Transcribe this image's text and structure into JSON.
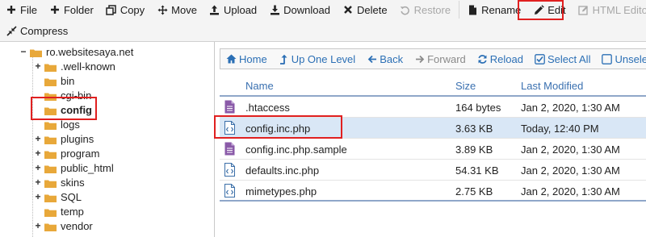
{
  "toolbar": {
    "row1": [
      {
        "key": "file",
        "label": "File",
        "icon": "plus-icon"
      },
      {
        "key": "folder",
        "label": "Folder",
        "icon": "plus-icon"
      },
      {
        "key": "copy",
        "label": "Copy",
        "icon": "copy-icon"
      },
      {
        "key": "move",
        "label": "Move",
        "icon": "move-icon"
      },
      {
        "key": "upload",
        "label": "Upload",
        "icon": "upload-icon"
      },
      {
        "key": "download",
        "label": "Download",
        "icon": "download-icon"
      },
      {
        "key": "delete",
        "label": "Delete",
        "icon": "close-icon"
      },
      {
        "key": "restore",
        "label": "Restore",
        "icon": "restore-icon",
        "disabled": true
      },
      {
        "key": "rename",
        "label": "Rename",
        "icon": "file-icon"
      },
      {
        "key": "edit",
        "label": "Edit",
        "icon": "pencil-icon"
      },
      {
        "key": "html_editor",
        "label": "HTML Editor",
        "icon": "edit-square-icon",
        "disabled": true
      }
    ],
    "compress_label": "Compress"
  },
  "tree": {
    "root": "ro.websitesaya.net",
    "items": [
      {
        "label": ".well-known",
        "expandable": true
      },
      {
        "label": "bin",
        "expandable": false
      },
      {
        "label": "cgi-bin",
        "expandable": false
      },
      {
        "label": "config",
        "expandable": false,
        "selected": true
      },
      {
        "label": "logs",
        "expandable": false
      },
      {
        "label": "plugins",
        "expandable": true
      },
      {
        "label": "program",
        "expandable": true
      },
      {
        "label": "public_html",
        "expandable": true
      },
      {
        "label": "skins",
        "expandable": true
      },
      {
        "label": "SQL",
        "expandable": true
      },
      {
        "label": "temp",
        "expandable": false
      },
      {
        "label": "vendor",
        "expandable": true
      }
    ]
  },
  "nav": {
    "home": "Home",
    "up": "Up One Level",
    "back": "Back",
    "forward": "Forward",
    "reload": "Reload",
    "select_all": "Select All",
    "unselect": "Unselect"
  },
  "table": {
    "headers": {
      "name": "Name",
      "size": "Size",
      "modified": "Last Modified"
    },
    "rows": [
      {
        "name": ".htaccess",
        "size": "164 bytes",
        "modified": "Jan 2, 2020, 1:30 AM",
        "icon": "text-file-icon"
      },
      {
        "name": "config.inc.php",
        "size": "3.63 KB",
        "modified": "Today, 12:40 PM",
        "icon": "code-file-icon",
        "selected": true
      },
      {
        "name": "config.inc.php.sample",
        "size": "3.89 KB",
        "modified": "Jan 2, 2020, 1:30 AM",
        "icon": "text-file-icon"
      },
      {
        "name": "defaults.inc.php",
        "size": "54.31 KB",
        "modified": "Jan 2, 2020, 1:30 AM",
        "icon": "code-file-icon"
      },
      {
        "name": "mimetypes.php",
        "size": "2.75 KB",
        "modified": "Jan 2, 2020, 1:30 AM",
        "icon": "code-file-icon"
      }
    ]
  },
  "colors": {
    "link": "#2b6fb5",
    "folder": "#e8a83a",
    "highlight": "#e02020",
    "selected_row": "#d9e7f6",
    "text_file_icon": "#8a5aa8",
    "code_file_icon": "#3a6ea8"
  }
}
